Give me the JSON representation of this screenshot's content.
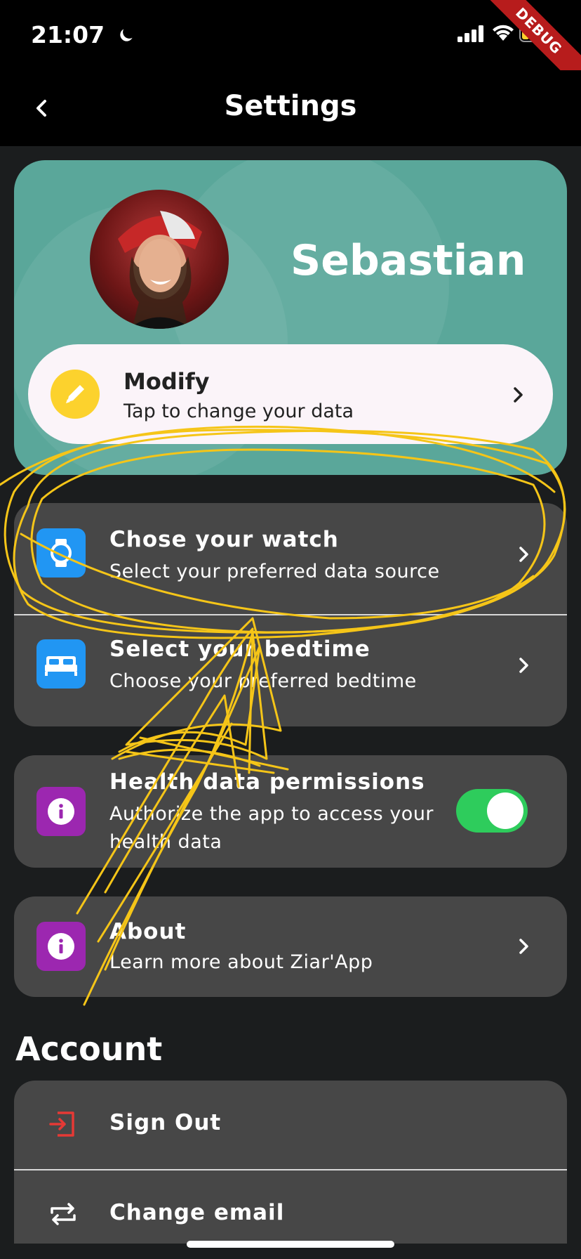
{
  "status_bar": {
    "time": "21:07",
    "debug_label": "DEBUG"
  },
  "app_bar": {
    "title": "Settings"
  },
  "profile": {
    "name": "Sebastian",
    "modify_title": "Modify",
    "modify_subtitle": "Tap to change your data"
  },
  "settings": [
    {
      "title": "Chose your watch",
      "subtitle": "Select your preferred data source",
      "icon": "watch-icon",
      "icon_color": "#2196f3"
    },
    {
      "title": "Select your bedtime",
      "subtitle": "Choose your preferred bedtime",
      "icon": "bed-icon",
      "icon_color": "#2196f3"
    },
    {
      "title": "Health data permissions",
      "subtitle_line1": "Authorize the app to access your",
      "subtitle_line2": "health data",
      "icon": "info-icon",
      "icon_color": "#9c27b0",
      "toggle_on": true
    },
    {
      "title": "About",
      "subtitle": "Learn more about Ziar'App",
      "icon": "info-icon",
      "icon_color": "#9c27b0"
    }
  ],
  "account": {
    "section_title": "Account",
    "items": [
      {
        "label": "Sign Out",
        "icon": "sign-out-icon",
        "icon_color": "#e53935"
      },
      {
        "label": "Change email",
        "icon": "swap-icon",
        "icon_color": "#ffffff"
      }
    ]
  },
  "colors": {
    "profile_card": "#5aa79a",
    "card_bg": "#474747",
    "accent_yellow": "#fcd22d",
    "toggle_on": "#2ecc5c"
  }
}
